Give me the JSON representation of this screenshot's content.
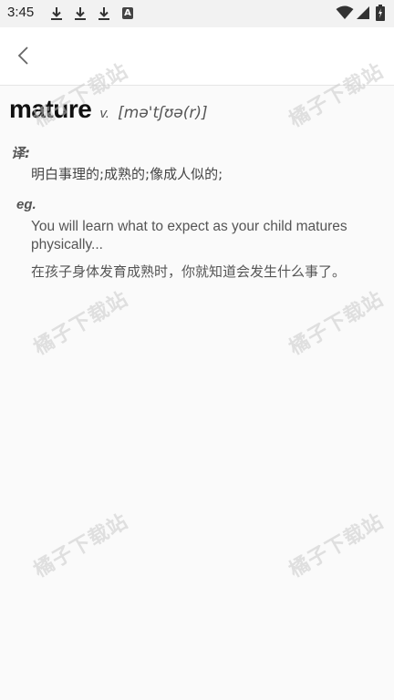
{
  "status_bar": {
    "time": "3:45",
    "notification_icons": [
      "download-icon",
      "download-icon",
      "download-icon",
      "a-app-icon"
    ],
    "notification_app_glyph": "A",
    "system_icons": [
      "wifi-icon",
      "signal-icon",
      "battery-icon"
    ]
  },
  "header": {
    "back_icon": "chevron-left-icon"
  },
  "entry": {
    "word": "mature",
    "part_of_speech": "v.",
    "phonetic": "[mə'tʃʊə(r)]",
    "translation_label": "译:",
    "translation": "明白事理的;成熟的;像成人似的;",
    "example_label": "eg.",
    "example_en": "You will learn what to expect as your child matures physically...",
    "example_zh": "在孩子身体发育成熟时，你就知道会发生什么事了。"
  },
  "watermark": {
    "text": "橘子下载站"
  },
  "colors": {
    "background": "#fafafa",
    "header_background": "#ffffff",
    "word_color": "#111111",
    "body_text": "#555555"
  }
}
